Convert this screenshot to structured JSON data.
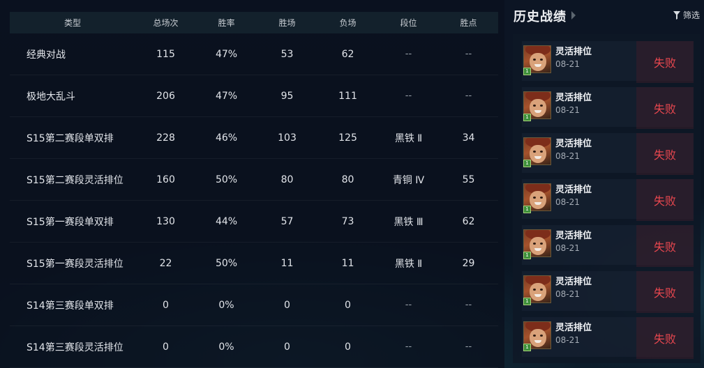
{
  "stats_table": {
    "headers": [
      "类型",
      "总场次",
      "胜率",
      "胜场",
      "负场",
      "段位",
      "胜点"
    ],
    "rows": [
      [
        "经典对战",
        "115",
        "47%",
        "53",
        "62",
        "--",
        "--"
      ],
      [
        "极地大乱斗",
        "206",
        "47%",
        "95",
        "111",
        "--",
        "--"
      ],
      [
        "S15第二赛段单双排",
        "228",
        "46%",
        "103",
        "125",
        "黑铁 Ⅱ",
        "34"
      ],
      [
        "S15第二赛段灵活排位",
        "160",
        "50%",
        "80",
        "80",
        "青铜 Ⅳ",
        "55"
      ],
      [
        "S15第一赛段单双排",
        "130",
        "44%",
        "57",
        "73",
        "黑铁 Ⅲ",
        "62"
      ],
      [
        "S15第一赛段灵活排位",
        "22",
        "50%",
        "11",
        "11",
        "黑铁 Ⅱ",
        "29"
      ],
      [
        "S14第三赛段单双排",
        "0",
        "0%",
        "0",
        "0",
        "--",
        "--"
      ],
      [
        "S14第三赛段灵活排位",
        "0",
        "0%",
        "0",
        "0",
        "--",
        "--"
      ]
    ]
  },
  "history": {
    "title": "历史战绩",
    "filter_label": "筛选",
    "matches": [
      {
        "queue": "灵活排位",
        "date": "08-21",
        "result": "失败",
        "level": "1"
      },
      {
        "queue": "灵活排位",
        "date": "08-21",
        "result": "失败",
        "level": "1"
      },
      {
        "queue": "灵活排位",
        "date": "08-21",
        "result": "失败",
        "level": "1"
      },
      {
        "queue": "灵活排位",
        "date": "08-21",
        "result": "失败",
        "level": "1"
      },
      {
        "queue": "灵活排位",
        "date": "08-21",
        "result": "失败",
        "level": "1"
      },
      {
        "queue": "灵活排位",
        "date": "08-21",
        "result": "失败",
        "level": "1"
      },
      {
        "queue": "灵活排位",
        "date": "08-21",
        "result": "失败",
        "level": "1"
      }
    ]
  },
  "colors": {
    "loss": "#e8474f",
    "header_bg": "#13212c",
    "page_bg": "#0a1220"
  }
}
